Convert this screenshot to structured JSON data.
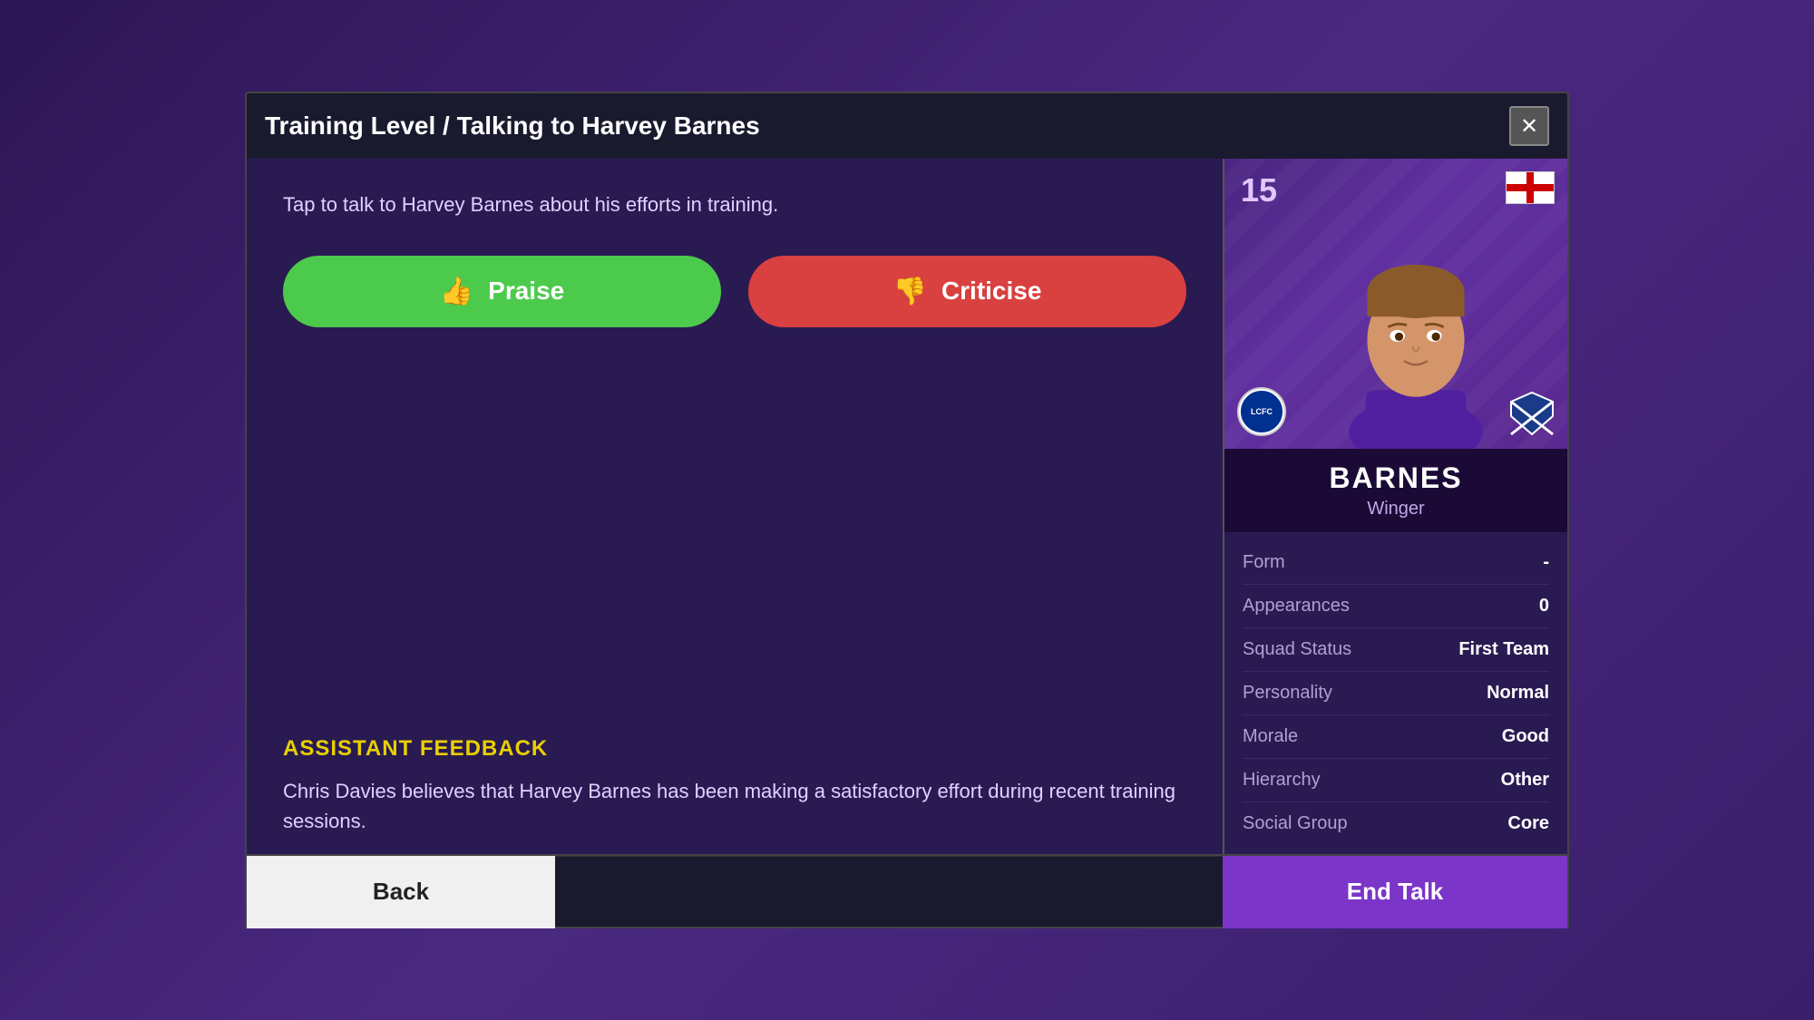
{
  "title_bar": {
    "title": "Training Level / Talking to Harvey Barnes",
    "close_label": "✕"
  },
  "left": {
    "intro_text": "Tap to talk to Harvey Barnes about his efforts in training.",
    "praise_label": "Praise",
    "criticise_label": "Criticise",
    "assistant_section_label": "ASSISTANT FEEDBACK",
    "assistant_text": "Chris Davies believes that Harvey Barnes has been making a satisfactory effort during recent training sessions."
  },
  "player_card": {
    "number": "15",
    "name": "BARNES",
    "position": "Winger",
    "stats": [
      {
        "label": "Form",
        "value": "-"
      },
      {
        "label": "Appearances",
        "value": "0"
      },
      {
        "label": "Squad Status",
        "value": "First Team"
      },
      {
        "label": "Personality",
        "value": "Normal"
      },
      {
        "label": "Morale",
        "value": "Good"
      },
      {
        "label": "Hierarchy",
        "value": "Other"
      },
      {
        "label": "Social Group",
        "value": "Core"
      }
    ]
  },
  "footer": {
    "back_label": "Back",
    "end_talk_label": "End Talk"
  }
}
